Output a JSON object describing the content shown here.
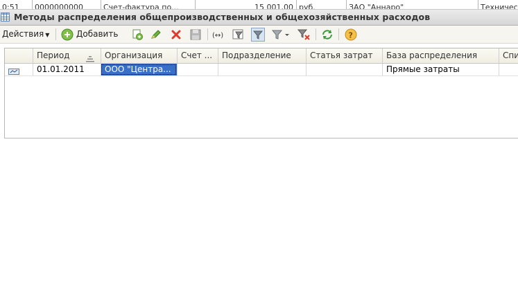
{
  "background_table": {
    "cells": [
      "0:51",
      "0000000000",
      "Счет-фактура по...",
      "15 001,00",
      "руб.",
      "ЗАО \"Аннаро\"",
      "Техничес"
    ]
  },
  "window": {
    "title": "Методы распределения общепроизводственных и общехозяйственных расходов",
    "icon": "table-icon"
  },
  "toolbar": {
    "actions_label": "Действия",
    "add_label": "Добавить",
    "buttons": [
      {
        "name": "copy-icon"
      },
      {
        "name": "edit-icon"
      },
      {
        "name": "delete-icon"
      },
      {
        "name": "save-icon"
      },
      {
        "name": "interval-icon"
      },
      {
        "name": "filter-settings-icon"
      },
      {
        "name": "filter-active-icon"
      },
      {
        "name": "filter-dropdown-icon"
      },
      {
        "name": "filter-clear-icon"
      },
      {
        "name": "refresh-icon"
      },
      {
        "name": "help-icon"
      }
    ]
  },
  "grid": {
    "columns": [
      "",
      "Период",
      "Организация",
      "Счет ...",
      "Подразделение",
      "Статья затрат",
      "База распределения",
      "Спи"
    ],
    "rows": [
      {
        "icon": "record-icon",
        "period": "01.01.2011",
        "organization": "ООО \"Центра...",
        "account": "",
        "subdivision": "",
        "cost_item": "",
        "distribution_base": "Прямые затраты",
        "extra": ""
      }
    ]
  },
  "colors": {
    "selection": "#3a6fc8",
    "header_bg": "#f0eee2",
    "toolbar_bg": "#f6f5f0"
  }
}
